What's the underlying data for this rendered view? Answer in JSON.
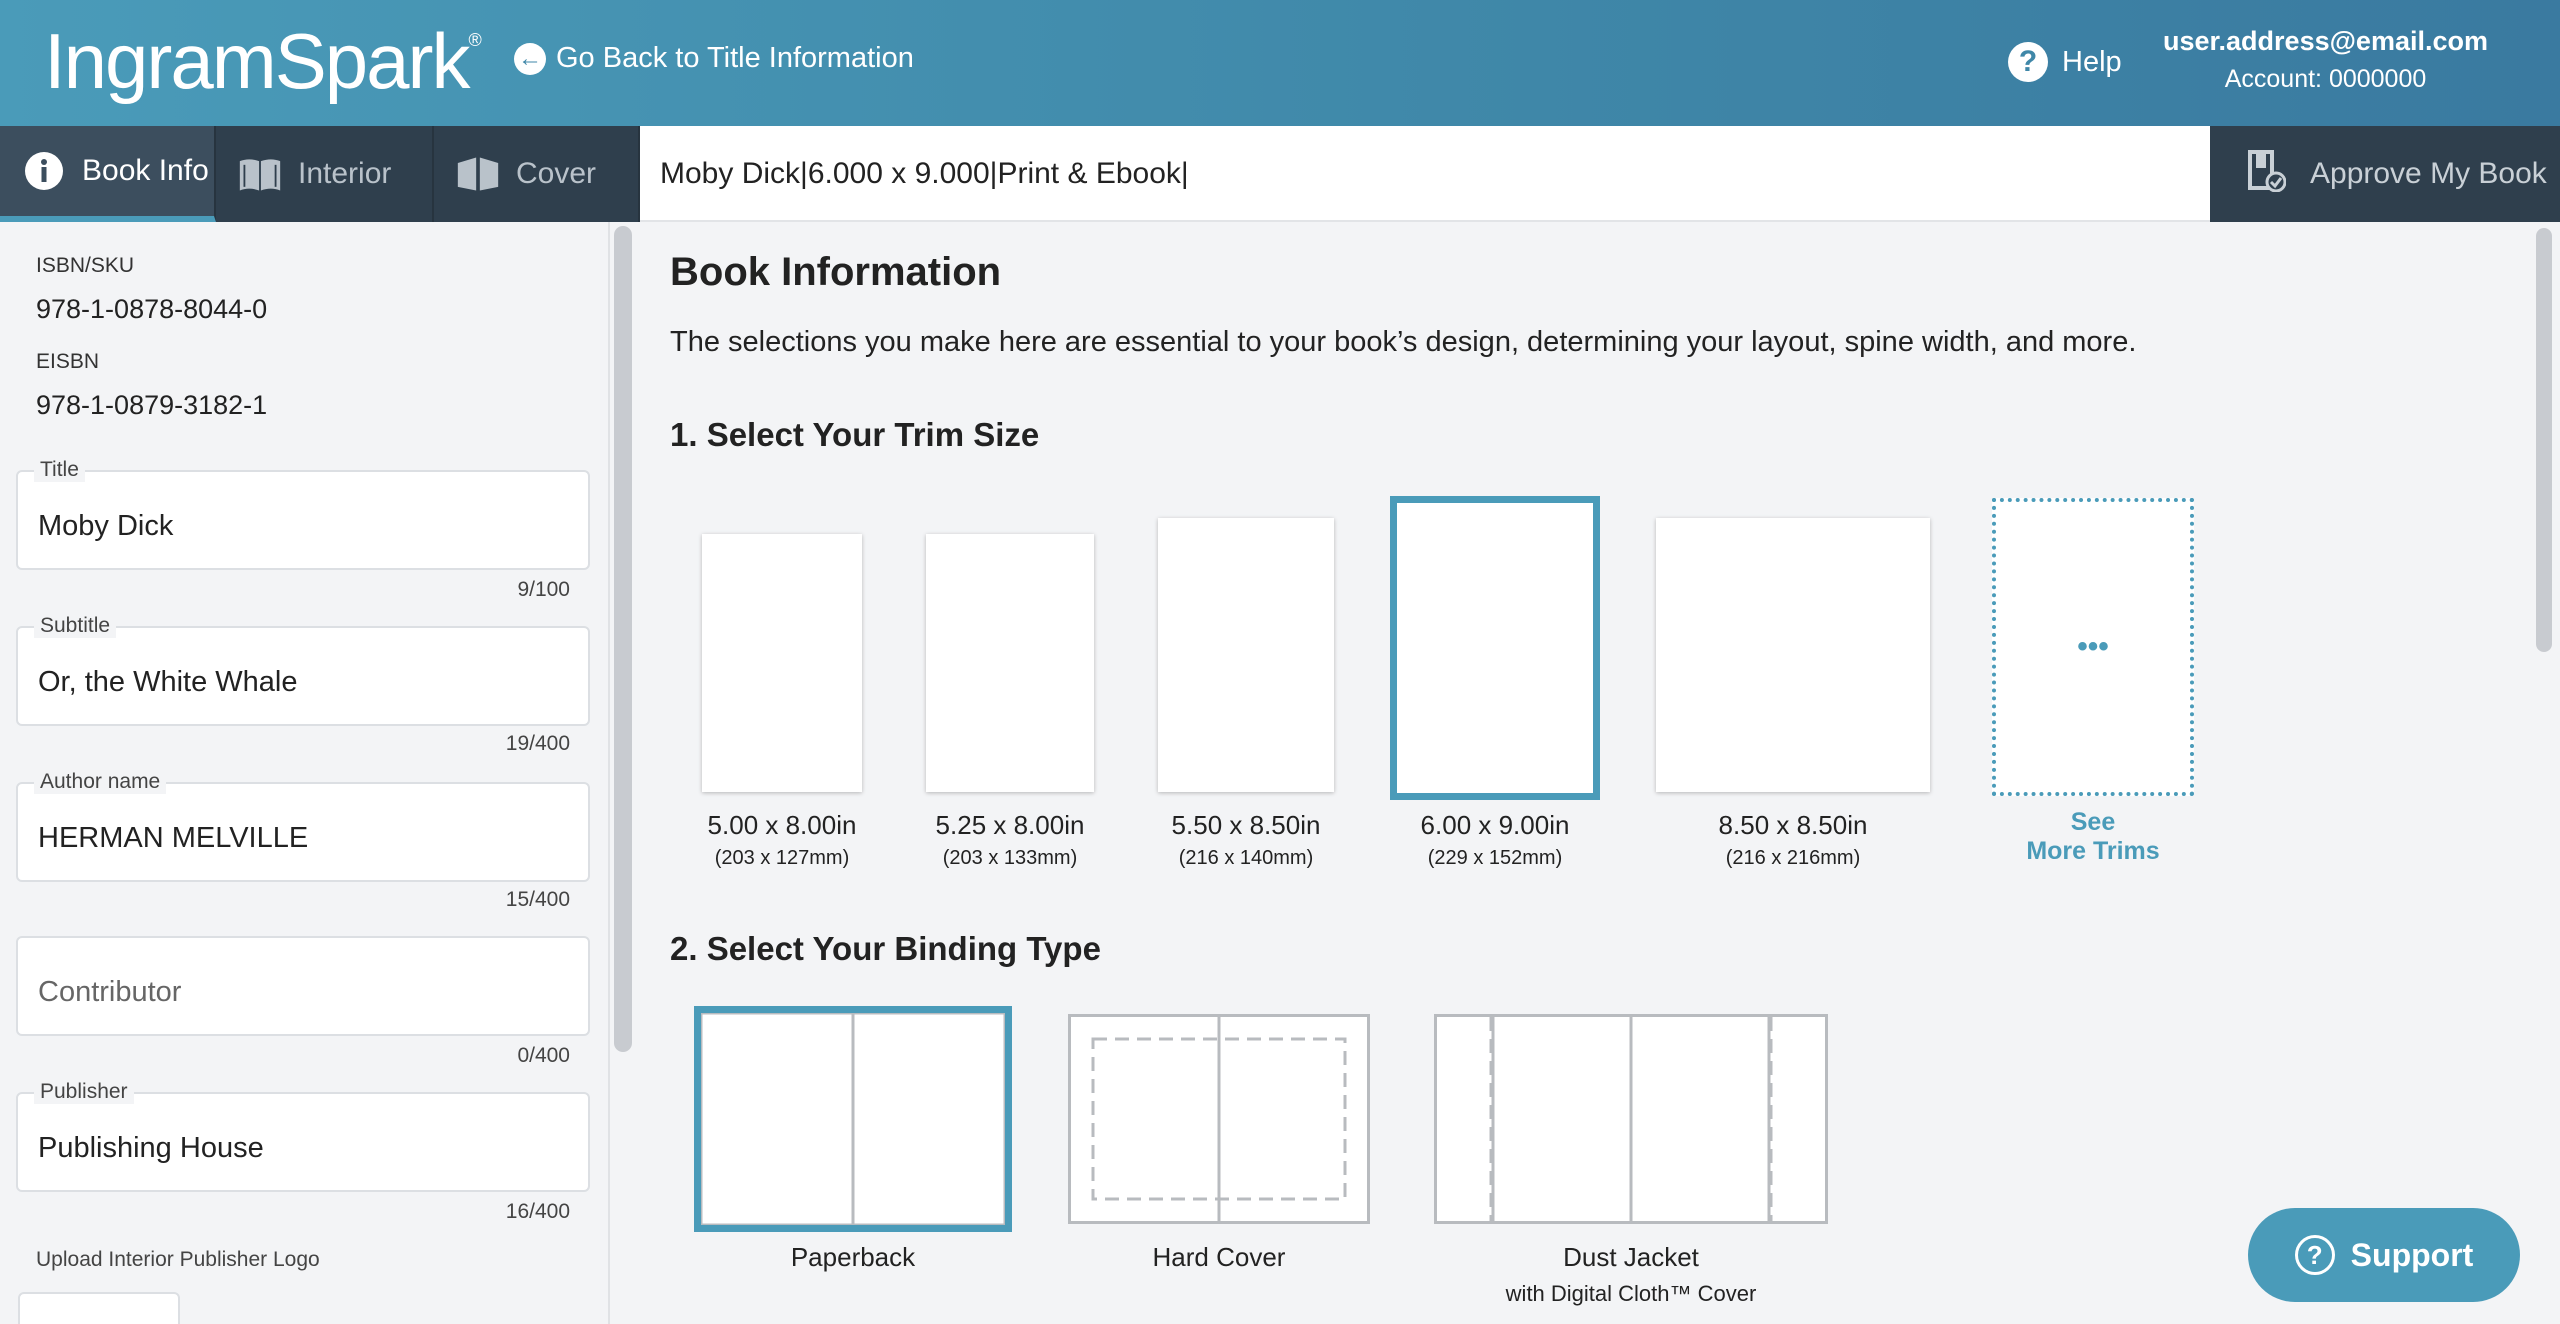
{
  "header": {
    "logo": "IngramSpark",
    "logo_mark": "®",
    "go_back": "Go Back to Title Information",
    "help": "Help",
    "email": "user.address@email.com",
    "account": "Account: 0000000"
  },
  "tabs": [
    {
      "label": "Book Info",
      "icon": "info-icon"
    },
    {
      "label": "Interior",
      "icon": "open-book-icon"
    },
    {
      "label": "Cover",
      "icon": "book-cover-icon"
    }
  ],
  "summary": {
    "title": "Moby Dick",
    "trim": "6.000 x 9.000",
    "format": "Print & Ebook",
    "sep": "|"
  },
  "approve": "Approve My Book",
  "sidebar": {
    "isbn_label": "ISBN/SKU",
    "isbn": "978-1-0878-8044-0",
    "eisbn_label": "EISBN",
    "eisbn": "978-1-0879-3182-1",
    "fields": [
      {
        "label": "Title",
        "value": "Moby Dick",
        "count": "9/100"
      },
      {
        "label": "Subtitle",
        "value": "Or, the White Whale",
        "count": "19/400"
      },
      {
        "label": "Author name",
        "value": "HERMAN MELVILLE",
        "count": "15/400"
      },
      {
        "label": "",
        "value": "Contributor",
        "count": "0/400"
      },
      {
        "label": "Publisher",
        "value": "Publishing House",
        "count": "16/400"
      }
    ],
    "upload_label": "Upload Interior Publisher Logo"
  },
  "main": {
    "title": "Book Information",
    "intro": "The selections you make here are essential to your book’s design, determining your layout, spine width, and more.",
    "trim_heading": "1. Select Your Trim Size",
    "trims": [
      {
        "in": "5.00 x 8.00in",
        "mm": "(203 x 127mm)"
      },
      {
        "in": "5.25 x 8.00in",
        "mm": "(203 x 133mm)"
      },
      {
        "in": "5.50 x 8.50in",
        "mm": "(216 x 140mm)"
      },
      {
        "in": "6.00 x 9.00in",
        "mm": "(229 x 152mm)"
      },
      {
        "in": "8.50 x 8.50in",
        "mm": "(216 x 216mm)"
      }
    ],
    "more_dots": "•••",
    "see_more_1": "See",
    "see_more_2": "More Trims",
    "binding_heading": "2. Select Your Binding Type",
    "bindings": [
      {
        "label": "Paperback"
      },
      {
        "label": "Hard Cover"
      },
      {
        "label": "Dust Jacket",
        "sub": "with Digital Cloth™ Cover"
      }
    ]
  },
  "support": "Support",
  "colors": {
    "accent": "#4a9bb9",
    "dark_nav": "#2f3f4d"
  }
}
